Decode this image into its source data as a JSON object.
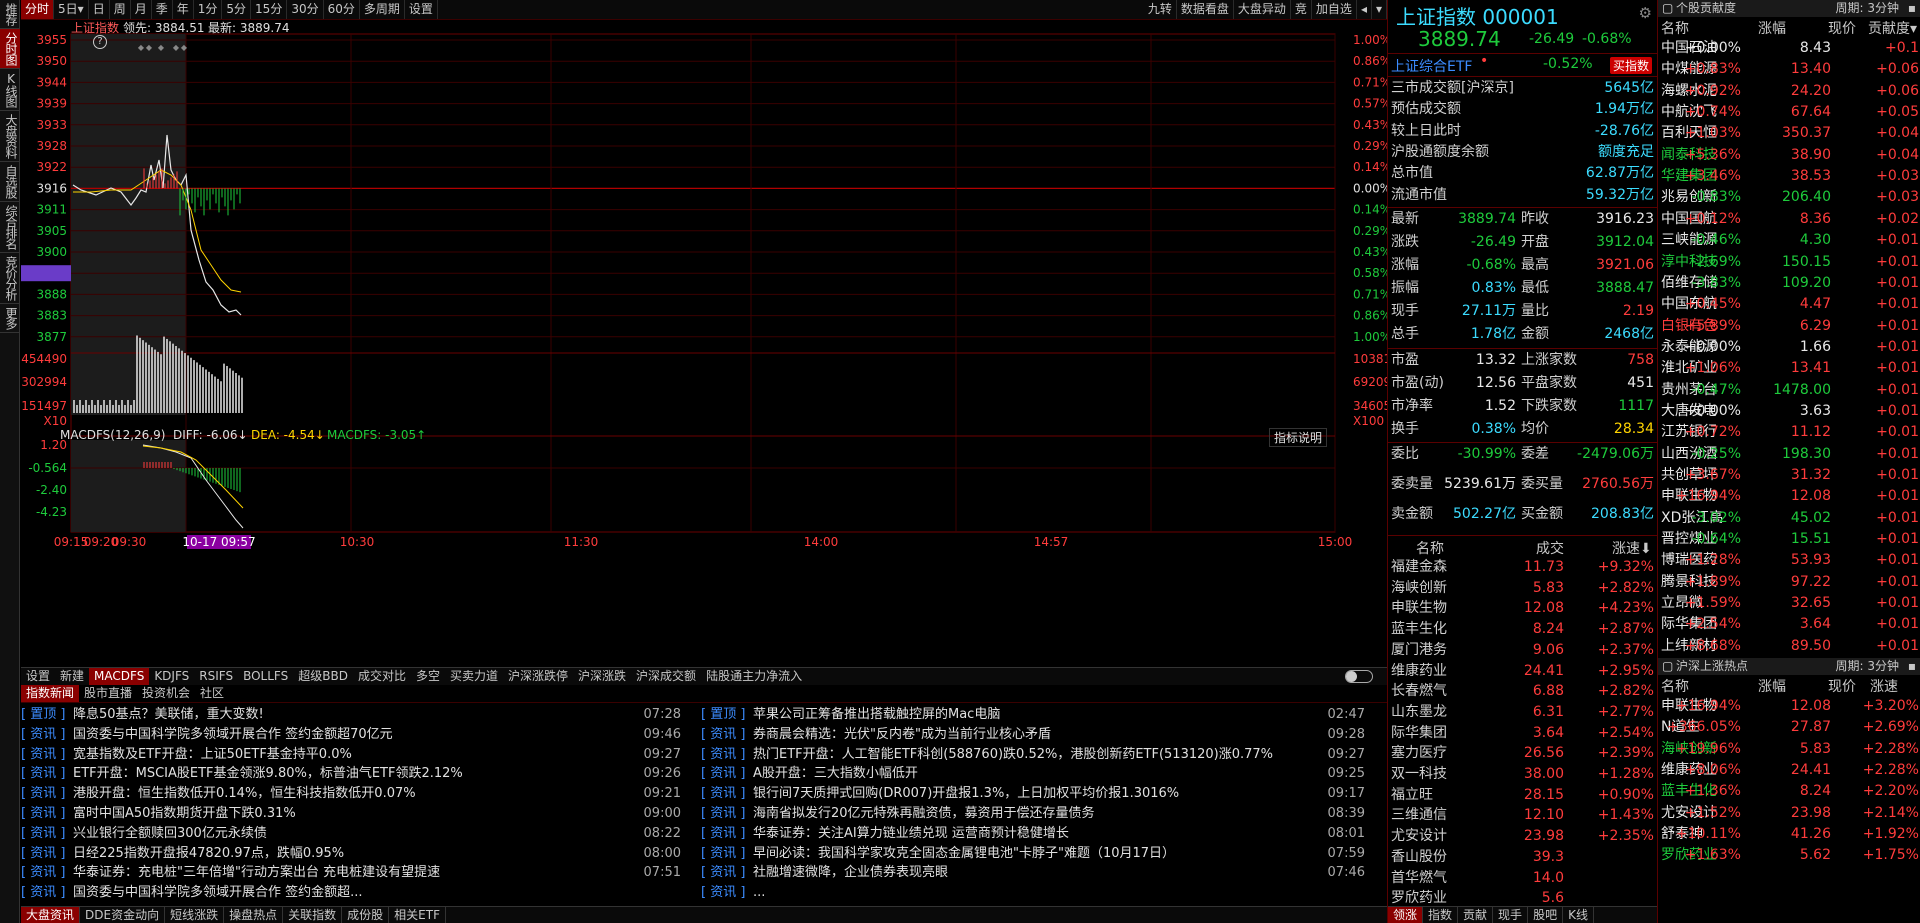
{
  "vtabs": [
    "推荐",
    "分时图",
    "K线图",
    "大盘资料",
    "自选股",
    "综合排名",
    "竞价分析",
    "更多"
  ],
  "toolbar": {
    "left": [
      "分时",
      "5日▾",
      "日",
      "周",
      "月",
      "季",
      "年",
      "1分",
      "5分",
      "15分",
      "30分",
      "60分",
      "多周期",
      "设置"
    ],
    "right": [
      "九转",
      "数据看盘",
      "大盘异动",
      "竞",
      "加自选",
      "◂",
      "▾"
    ]
  },
  "chart": {
    "index_label": "上证指数",
    "lead_label": "领先: 3884.51",
    "latest_label": "最新: 3889.74",
    "price_ticks": [
      "3955",
      "3950",
      "3944",
      "3939",
      "3933",
      "3928",
      "3922",
      "3916",
      "3911",
      "3905",
      "3900",
      "3894",
      "3888",
      "3883",
      "3877"
    ],
    "pct_ticks": [
      "1.00%",
      "0.86%",
      "0.71%",
      "0.57%",
      "0.43%",
      "0.29%",
      "0.14%",
      "0.00%",
      "0.14%",
      "0.29%",
      "0.43%",
      "0.58%",
      "0.71%",
      "0.86%",
      "1.00%"
    ],
    "vol_left": [
      "454490",
      "302994",
      "151497",
      "X10"
    ],
    "vol_right": [
      "103814",
      "69209",
      "34605",
      "X100"
    ],
    "macd_label": "MACDFS(12,26,9)",
    "diff_label": "DIFF: -6.06↓",
    "dea_label": "DEA: -4.54↓",
    "macdfs_label": "MACDFS: -3.05↑",
    "hint": "指标说明",
    "macd_ticks": [
      "1.20",
      "-0.564",
      "-2.40",
      "-4.23"
    ],
    "time_ticks": [
      "09:15",
      "09:20",
      "09:30",
      "10:30",
      "11:30",
      "14:00",
      "14:57",
      "15:00"
    ],
    "cursor_time": "10-17 09:57"
  },
  "indicator_tabs": [
    "设置",
    "新建",
    "MACDFS",
    "KDJFS",
    "RSIFS",
    "BOLLFS",
    "超级BBD",
    "成交对比",
    "多空",
    "买卖力道",
    "沪深涨跌停",
    "沪深涨跌",
    "沪深成交额",
    "陆股通主力净流入"
  ],
  "news_tabs": [
    "指数新闻",
    "股市直播",
    "投资机会",
    "社区"
  ],
  "news_left": [
    {
      "tag": "[ 置顶 ]",
      "title": "降息50基点？美联储，重大变数!",
      "time": "07:28"
    },
    {
      "tag": "[ 资讯 ]",
      "title": "国资委与中国科学院多领域开展合作 签约金额超70亿元",
      "time": "09:46"
    },
    {
      "tag": "[ 资讯 ]",
      "title": "宽基指数及ETF开盘：上证50ETF基金持平0.0%",
      "time": "09:27"
    },
    {
      "tag": "[ 资讯 ]",
      "title": "ETF开盘：MSCIA股ETF基金领涨9.80%，标普油气ETF领跌2.12%",
      "time": "09:26"
    },
    {
      "tag": "[ 资讯 ]",
      "title": "港股开盘：恒生指数低开0.14%，恒生科技指数低开0.07%",
      "time": "09:21"
    },
    {
      "tag": "[ 资讯 ]",
      "title": "富时中国A50指数期货开盘下跌0.31%",
      "time": "09:00"
    },
    {
      "tag": "[ 资讯 ]",
      "title": "兴业银行全额赎回300亿元永续债",
      "time": "08:22"
    },
    {
      "tag": "[ 资讯 ]",
      "title": "日经225指数开盘报47820.97点，跌幅0.95%",
      "time": "08:00"
    },
    {
      "tag": "[ 资讯 ]",
      "title": "华泰证券：充电桩\"三年倍增\"行动方案出台 充电桩建设有望提速",
      "time": "07:51"
    },
    {
      "tag": "[ 资讯 ]",
      "title": "国资委与中国科学院多领域开展合作 签约金额超...",
      "time": ""
    }
  ],
  "news_right": [
    {
      "tag": "[ 置顶 ]",
      "title": "苹果公司正筹备推出搭载触控屏的Mac电脑",
      "time": "02:47"
    },
    {
      "tag": "[ 资讯 ]",
      "title": "券商晨会精选：光伏\"反内卷\"成为当前行业核心矛盾",
      "time": "09:28"
    },
    {
      "tag": "[ 资讯 ]",
      "title": "热门ETF开盘：人工智能ETF科创(588760)跌0.52%，港股创新药ETF(513120)涨0.77%",
      "time": "09:27"
    },
    {
      "tag": "[ 资讯 ]",
      "title": "A股开盘：三大指数小幅低开",
      "time": "09:25"
    },
    {
      "tag": "[ 资讯 ]",
      "title": "银行间7天质押式回购(DR007)开盘报1.3%，上日加权平均价报1.3016%",
      "time": "09:17"
    },
    {
      "tag": "[ 资讯 ]",
      "title": "海南省拟发行20亿元特殊再融资债，募资用于偿还存量债务",
      "time": "08:39"
    },
    {
      "tag": "[ 资讯 ]",
      "title": "华泰证券：关注AI算力链业绩兑现 运营商预计稳健增长",
      "time": "08:01"
    },
    {
      "tag": "[ 资讯 ]",
      "title": "早间必读：我国科学家攻克全固态金属锂电池\"卡脖子\"难题（10月17日）",
      "time": "07:59"
    },
    {
      "tag": "[ 资讯 ]",
      "title": "社融增速微降，企业债券表现亮眼",
      "time": "07:46"
    },
    {
      "tag": "[ 资讯 ]",
      "title": "...",
      "time": ""
    }
  ],
  "bottom_tabs": [
    "大盘资讯",
    "DDE资金动向",
    "短线涨跌",
    "操盘热点",
    "关联指数",
    "成份股",
    "相关ETF"
  ],
  "index": {
    "name": "上证指数 000001",
    "price": "3889.74",
    "change": "-26.49",
    "pct": "-0.68%",
    "etf_label": "上证综合ETF",
    "etf_mark": "•",
    "etf_pct": "-0.52%",
    "buy_btn": "买指数"
  },
  "stats_a": [
    {
      "k": "三市成交额[沪深京]",
      "v": "5645亿",
      "c": "cy"
    },
    {
      "k": "预估成交额",
      "v": "1.94万亿",
      "c": "cy"
    },
    {
      "k": "较上日此时",
      "v": "-28.76亿",
      "c": "cy"
    },
    {
      "k": "沪股通额度余额",
      "v": "额度充足",
      "c": "cy"
    },
    {
      "k": "总市值",
      "v": "62.87万亿",
      "c": "cy"
    },
    {
      "k": "流通市值",
      "v": "59.32万亿",
      "c": "cy"
    }
  ],
  "stats_b": [
    {
      "k": "最新",
      "v1": "3889.74",
      "c1": "dn",
      "k2": "昨收",
      "v": "3916.23",
      "c": "wh"
    },
    {
      "k": "涨跌",
      "v1": "-26.49",
      "c1": "dn",
      "k2": "开盘",
      "v": "3912.04",
      "c": "dn"
    },
    {
      "k": "涨幅",
      "v1": "-0.68%",
      "c1": "dn",
      "k2": "最高",
      "v": "3921.06",
      "c": "up"
    },
    {
      "k": "振幅",
      "v1": "0.83%",
      "c1": "cy",
      "k2": "最低",
      "v": "3888.47",
      "c": "dn"
    },
    {
      "k": "现手",
      "v1": "27.11万",
      "c1": "cy",
      "k2": "量比",
      "v": "2.19",
      "c": "up"
    },
    {
      "k": "总手",
      "v1": "1.78亿",
      "c1": "cy",
      "k2": "金额",
      "v": "2468亿",
      "c": "cy"
    }
  ],
  "stats_c": [
    {
      "k": "市盈",
      "v1": "13.32",
      "c1": "wh",
      "k2": "上涨家数",
      "v": "758",
      "c": "up"
    },
    {
      "k": "市盈(动)",
      "v1": "12.56",
      "c1": "wh",
      "k2": "平盘家数",
      "v": "451",
      "c": "wh"
    },
    {
      "k": "市净率",
      "v1": "1.52",
      "c1": "wh",
      "k2": "下跌家数",
      "v": "1117",
      "c": "dn"
    },
    {
      "k": "换手",
      "v1": "0.38%",
      "c1": "cy",
      "k2": "均价",
      "v": "28.34",
      "c": "yl"
    }
  ],
  "stats_d": [
    {
      "k": "委比",
      "v1": "-30.99%",
      "c1": "dn",
      "k2": "委差",
      "v": "-2479.06万",
      "c": "dn"
    },
    {
      "k": "委卖量",
      "v1": "5239.61万",
      "c1": "wh",
      "k2": "委买量",
      "v": "2760.56万",
      "c": "up"
    },
    {
      "k": "卖金额",
      "v1": "502.27亿",
      "c1": "cy",
      "k2": "买金额",
      "v": "208.83亿",
      "c": "cy"
    }
  ],
  "mid_list_header": {
    "name": "名称",
    "deal": "成交",
    "chg": "涨速⬇"
  },
  "mid_list": [
    {
      "n": "福建金森",
      "nc": "wh",
      "a": "11.73",
      "b": "+9.32%"
    },
    {
      "n": "海峡创新",
      "nc": "dn",
      "a": "5.83",
      "b": "+2.82%"
    },
    {
      "n": "申联生物",
      "nc": "wh",
      "a": "12.08",
      "b": "+4.23%"
    },
    {
      "n": "蓝丰生化",
      "nc": "dn",
      "a": "8.24",
      "b": "+2.87%"
    },
    {
      "n": "厦门港务",
      "nc": "wh",
      "a": "9.06",
      "b": "+2.37%"
    },
    {
      "n": "维康药业",
      "nc": "wh",
      "a": "24.41",
      "b": "+2.95%"
    },
    {
      "n": "长春燃气",
      "nc": "wh",
      "a": "6.88",
      "b": "+2.82%"
    },
    {
      "n": "山东墨龙",
      "nc": "wh",
      "a": "6.31",
      "b": "+2.77%"
    },
    {
      "n": "际华集团",
      "nc": "wh",
      "a": "3.64",
      "b": "+2.54%"
    },
    {
      "n": "塞力医疗",
      "nc": "dn",
      "a": "26.56",
      "b": "+2.39%"
    },
    {
      "n": "双一科技",
      "nc": "wh",
      "a": "38.00",
      "b": "+1.28%"
    },
    {
      "n": "福立旺",
      "nc": "wh",
      "a": "28.15",
      "b": "+0.90%"
    },
    {
      "n": "三维通信",
      "nc": "wh",
      "a": "12.10",
      "b": "+1.43%"
    },
    {
      "n": "尤安设计",
      "nc": "wh",
      "a": "23.98",
      "b": "+2.35%"
    },
    {
      "n": "香山股份",
      "nc": "wh",
      "a": "39.3",
      "b": ""
    },
    {
      "n": "首华燃气",
      "nc": "wh",
      "a": "14.0",
      "b": ""
    },
    {
      "n": "罗欣药业",
      "nc": "dn",
      "a": "5.6",
      "b": ""
    }
  ],
  "mid_bottom_tabs": [
    "领涨",
    "指数",
    "贡献",
    "现手",
    "股吧",
    "K线"
  ],
  "right_hdr1": {
    "title": "个股贡献度",
    "period": "周期: 3分钟"
  },
  "right_cols": {
    "n": "名称",
    "c1": "涨幅",
    "c2": "现价",
    "c3": "贡献度▾"
  },
  "right_list1": [
    {
      "n": "中国石油",
      "nc": "wh",
      "c1": "+0.00%",
      "c2": "8.43",
      "c3": "+0.1"
    },
    {
      "n": "中煤能源",
      "nc": "wh",
      "c1": "+0.83%",
      "c2": "13.40",
      "c3": "+0.06"
    },
    {
      "n": "海螺水泥",
      "nc": "wh",
      "c1": "+0.92%",
      "c2": "24.20",
      "c3": "+0.06"
    },
    {
      "n": "中航沈飞",
      "nc": "wh",
      "c1": "+0.74%",
      "c2": "67.64",
      "c3": "+0.05"
    },
    {
      "n": "百利天恒",
      "nc": "wh",
      "c1": "+1.03%",
      "c2": "350.37",
      "c3": "+0.04"
    },
    {
      "n": "闻泰科技",
      "nc": "dn",
      "c1": "+5.36%",
      "c2": "38.90",
      "c3": "+0.04"
    },
    {
      "n": "华建集团",
      "nc": "dn",
      "c1": "+3.46%",
      "c2": "38.53",
      "c3": "+0.03"
    },
    {
      "n": "兆易创新",
      "nc": "wh",
      "c1": "-0.83%",
      "c2": "206.40",
      "c3": "+0.03"
    },
    {
      "n": "中国国航",
      "nc": "wh",
      "c1": "+0.12%",
      "c2": "8.36",
      "c3": "+0.02"
    },
    {
      "n": "三峡能源",
      "nc": "wh",
      "c1": "-0.46%",
      "c2": "4.30",
      "c3": "+0.01"
    },
    {
      "n": "淳中科技",
      "nc": "dn",
      "c1": "-2.69%",
      "c2": "150.15",
      "c3": "+0.01"
    },
    {
      "n": "佰维存储",
      "nc": "wh",
      "c1": "-3.83%",
      "c2": "109.20",
      "c3": "+0.01"
    },
    {
      "n": "中国东航",
      "nc": "wh",
      "c1": "+0.45%",
      "c2": "4.47",
      "c3": "+0.01"
    },
    {
      "n": "白银有色",
      "nc": "up",
      "c1": "+5.89%",
      "c2": "6.29",
      "c3": "+0.01"
    },
    {
      "n": "永泰能源",
      "nc": "wh",
      "c1": "+0.00%",
      "c2": "1.66",
      "c3": "+0.01"
    },
    {
      "n": "淮北矿业",
      "nc": "wh",
      "c1": "+1.06%",
      "c2": "13.41",
      "c3": "+0.01"
    },
    {
      "n": "贵州茅台",
      "nc": "wh",
      "c1": "-0.47%",
      "c2": "1478.00",
      "c3": "+0.01"
    },
    {
      "n": "大唐发电",
      "nc": "wh",
      "c1": "+0.00%",
      "c2": "3.63",
      "c3": "+0.01"
    },
    {
      "n": "江苏银行",
      "nc": "wh",
      "c1": "+0.72%",
      "c2": "11.12",
      "c3": "+0.01"
    },
    {
      "n": "山西汾酒",
      "nc": "wh",
      "c1": "-0.25%",
      "c2": "198.30",
      "c3": "+0.01"
    },
    {
      "n": "共创草坪",
      "nc": "wh",
      "c1": "+3.67%",
      "c2": "31.32",
      "c3": "+0.01"
    },
    {
      "n": "申联生物",
      "nc": "wh",
      "c1": "+16.94%",
      "c2": "12.08",
      "c3": "+0.01"
    },
    {
      "n": "XD张江高",
      "nc": "wh",
      "c1": "-3.02%",
      "c2": "45.02",
      "c3": "+0.01"
    },
    {
      "n": "晋控煤业",
      "nc": "wh",
      "c1": "-0.64%",
      "c2": "15.51",
      "c3": "+0.01"
    },
    {
      "n": "博瑞医药",
      "nc": "wh",
      "c1": "+1.28%",
      "c2": "53.93",
      "c3": "+0.01"
    },
    {
      "n": "腾景科技",
      "nc": "wh",
      "c1": "+1.89%",
      "c2": "97.22",
      "c3": "+0.01"
    },
    {
      "n": "立昂微",
      "nc": "wh",
      "c1": "+1.59%",
      "c2": "32.65",
      "c3": "+0.01"
    },
    {
      "n": "际华集团",
      "nc": "wh",
      "c1": "+2.54%",
      "c2": "3.64",
      "c3": "+0.01"
    },
    {
      "n": "上纬新材",
      "nc": "wh",
      "c1": "+8.68%",
      "c2": "89.50",
      "c3": "+0.01"
    }
  ],
  "right_hdr2": {
    "title": "沪深上涨热点",
    "period": "周期: 3分钟"
  },
  "right_list2": [
    {
      "n": "申联生物",
      "nc": "wh",
      "c1": "+16.94%",
      "c2": "12.08",
      "c3": "+3.20%"
    },
    {
      "n": "N道生",
      "nc": "wh",
      "c1": "+366.05%",
      "c2": "27.87",
      "c3": "+2.69%"
    },
    {
      "n": "海峡创新",
      "nc": "dn",
      "c1": "+19.96%",
      "c2": "5.83",
      "c3": "+2.28%"
    },
    {
      "n": "维康药业",
      "nc": "wh",
      "c1": "+8.06%",
      "c2": "24.41",
      "c3": "+2.28%"
    },
    {
      "n": "蓝丰生化",
      "nc": "dn",
      "c1": "+1.36%",
      "c2": "8.24",
      "c3": "+2.20%"
    },
    {
      "n": "尤安设计",
      "nc": "wh",
      "c1": "+1.52%",
      "c2": "23.98",
      "c3": "+2.14%"
    },
    {
      "n": "舒泰神",
      "nc": "wh",
      "c1": "+10.11%",
      "c2": "41.26",
      "c3": "+1.92%"
    },
    {
      "n": "罗欣药业",
      "nc": "dn",
      "c1": "+1.63%",
      "c2": "5.62",
      "c3": "+1.75%"
    }
  ],
  "colors": {
    "up": "#ff3c3c",
    "down": "#1ecb3c",
    "accent": "#8a0000",
    "grid": "#5a0000",
    "price": "#e8e8e8",
    "avg": "#ffd400"
  }
}
